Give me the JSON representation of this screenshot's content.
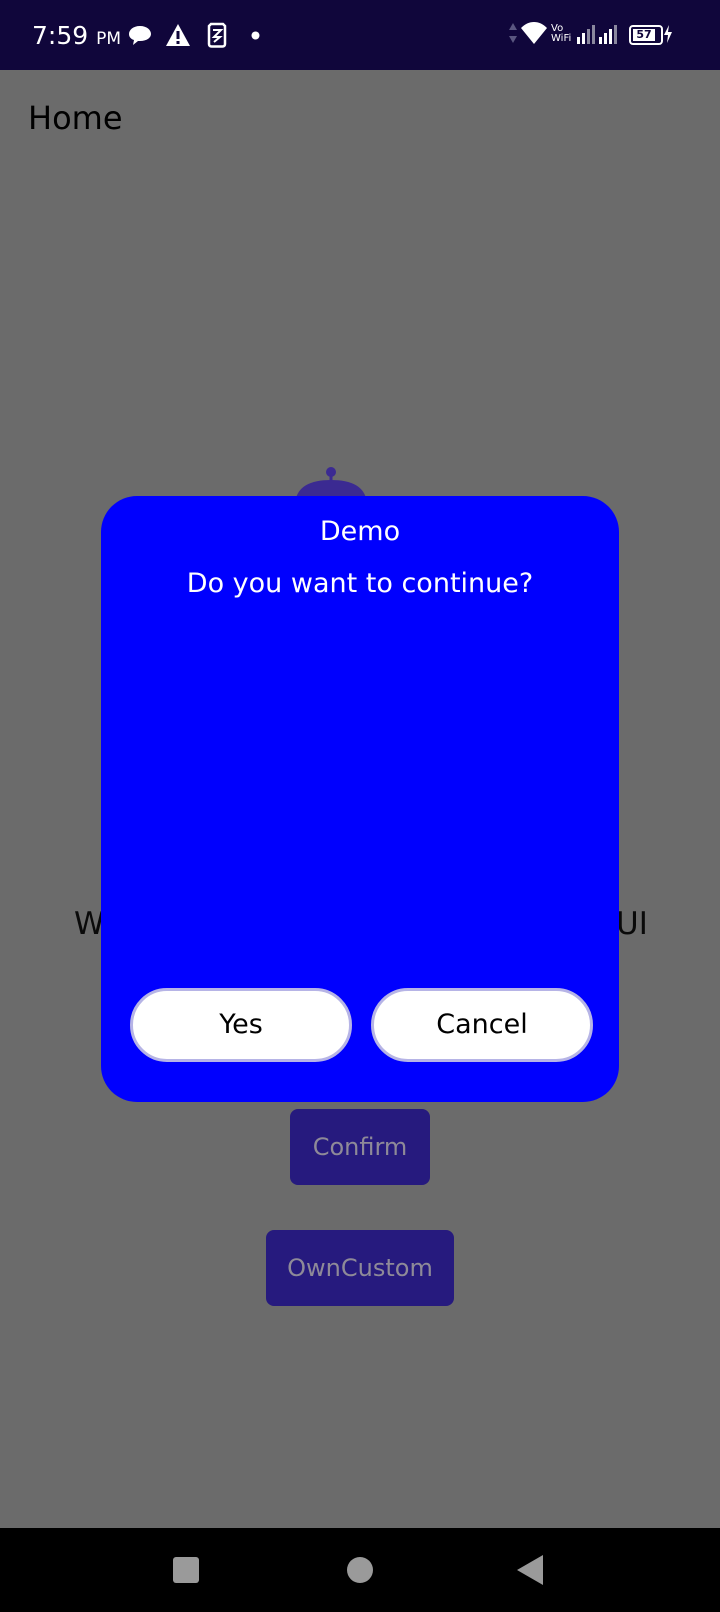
{
  "status_bar": {
    "time": "7:59",
    "ampm": "PM",
    "battery": "57",
    "vowifi_top": "Vo",
    "vowifi_bottom": "WiFi",
    "icons": [
      "chat-bubble-icon",
      "warning-icon",
      "sim-icon",
      "dot-icon",
      "data-arrows-icon",
      "wifi-icon",
      "signal-icon",
      "battery-icon",
      "charging-icon"
    ],
    "bg_color": "#10063b"
  },
  "page": {
    "title": "Home",
    "welcome_left": "W",
    "welcome_right": "UI",
    "buttons": {
      "confirm": "Confirm",
      "own_custom": "OwnCustom"
    },
    "overlay_color": "#6b6b6b",
    "button_color": "#261a7e"
  },
  "dialog": {
    "title": "Demo",
    "message": "Do you want to continue?",
    "yes": "Yes",
    "cancel": "Cancel",
    "bg_color": "#0000fe"
  },
  "nav_bar": {
    "icons": [
      "recents-square-icon",
      "home-circle-icon",
      "back-triangle-icon"
    ]
  }
}
